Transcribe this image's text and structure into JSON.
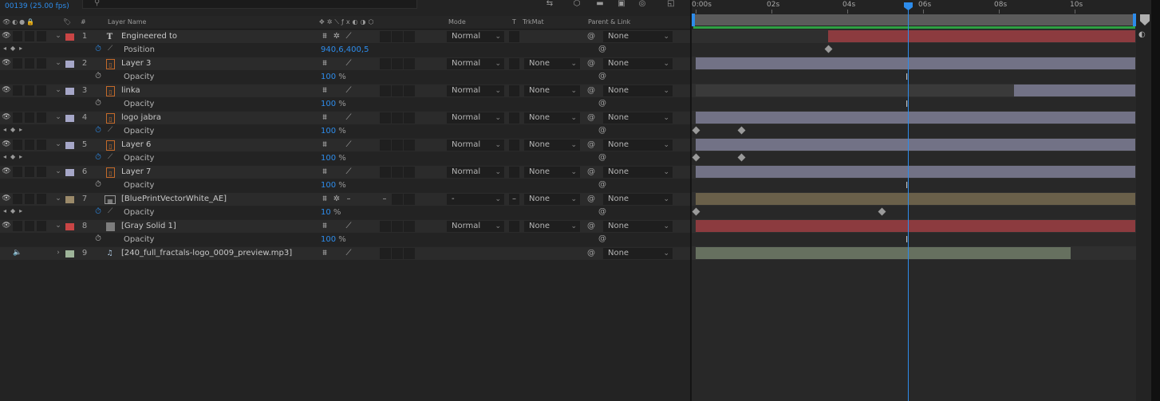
{
  "header": {
    "timecode": "00139 (25.00 fps)"
  },
  "columns": {
    "layer_name": "Layer Name",
    "mode": "Mode",
    "t": "T",
    "trkmat": "TrkMat",
    "parent": "Parent & Link",
    "num": "#"
  },
  "ruler": {
    "ticks": [
      "0:00s",
      "02s",
      "04s",
      "06s",
      "08s",
      "10s"
    ]
  },
  "layers": [
    {
      "num": "1",
      "name": "Engineered to",
      "type": "text",
      "label_color": "#c94545",
      "mode": "Normal",
      "trkmat": "",
      "parent": "None",
      "prop": {
        "name": "Position",
        "value": "940,6,400,5",
        "unit": "",
        "animated": true
      }
    },
    {
      "num": "2",
      "name": "Layer 3",
      "type": "precomp",
      "label_color": "#a6a7c8",
      "mode": "Normal",
      "trkmat": "None",
      "parent": "None",
      "prop": {
        "name": "Opacity",
        "value": "100",
        "unit": "%",
        "animated": false
      }
    },
    {
      "num": "3",
      "name": "linka",
      "type": "precomp",
      "label_color": "#a6a7c8",
      "mode": "Normal",
      "trkmat": "None",
      "parent": "None",
      "prop": {
        "name": "Opacity",
        "value": "100",
        "unit": "%",
        "animated": false
      }
    },
    {
      "num": "4",
      "name": "logo jabra",
      "type": "precomp",
      "label_color": "#a6a7c8",
      "mode": "Normal",
      "trkmat": "None",
      "parent": "None",
      "prop": {
        "name": "Opacity",
        "value": "100",
        "unit": "%",
        "animated": true
      }
    },
    {
      "num": "5",
      "name": "Layer 6",
      "type": "precomp",
      "label_color": "#a6a7c8",
      "mode": "Normal",
      "trkmat": "None",
      "parent": "None",
      "prop": {
        "name": "Opacity",
        "value": "100",
        "unit": "%",
        "animated": true
      }
    },
    {
      "num": "6",
      "name": "Layer 7",
      "type": "precomp",
      "label_color": "#a6a7c8",
      "mode": "Normal",
      "trkmat": "None",
      "parent": "None",
      "prop": {
        "name": "Opacity",
        "value": "100",
        "unit": "%",
        "animated": false
      }
    },
    {
      "num": "7",
      "name": "[BluePrintVectorWhite_AE]",
      "type": "footage",
      "label_color": "#9b8a6a",
      "mode": "-",
      "trkmat": "None",
      "parent": "None",
      "prop": {
        "name": "Opacity",
        "value": "10",
        "unit": "%",
        "animated": true
      }
    },
    {
      "num": "8",
      "name": "[Gray Solid 1]",
      "type": "solid",
      "label_color": "#c94545",
      "mode": "Normal",
      "trkmat": "None",
      "parent": "None",
      "prop": {
        "name": "Opacity",
        "value": "100",
        "unit": "%",
        "animated": false
      }
    },
    {
      "num": "9",
      "name": "[240_full_fractals-logo_0009_preview.mp3]",
      "type": "audio",
      "label_color": "#9fb59a",
      "mode": "",
      "trkmat": "",
      "parent": "None",
      "prop": null
    }
  ],
  "colors": {
    "accent": "#2d8ceb",
    "work_area_green": "#2ea043",
    "bar_red": "#8c3b3f",
    "bar_lavender": "#727286",
    "bar_tan": "#6a604a",
    "bar_sage": "#66705f"
  },
  "timeline": {
    "duration_s": 11.6,
    "playhead_s": 5.6
  }
}
